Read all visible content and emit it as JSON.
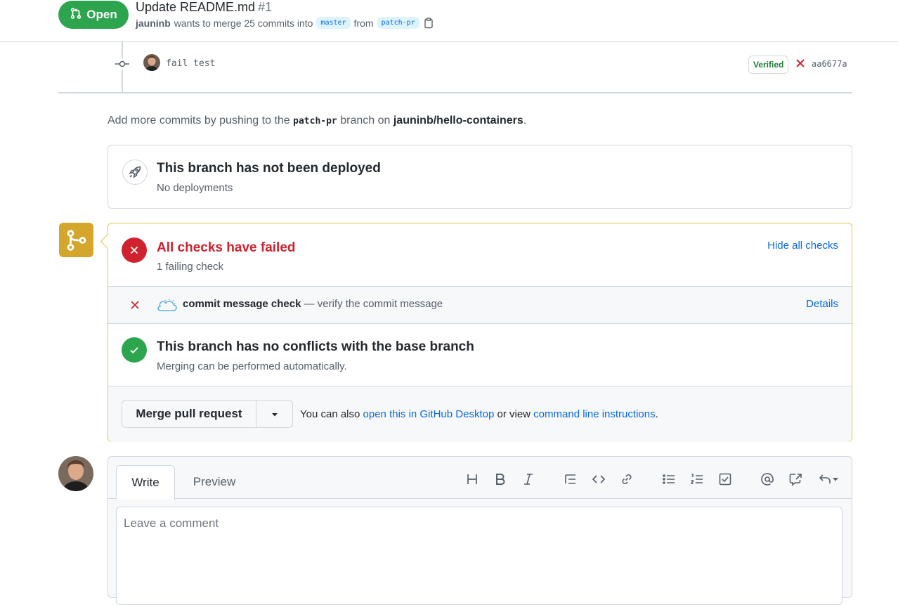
{
  "header": {
    "state": "Open",
    "title": "Update README.md",
    "number": "#1",
    "author": "jauninb",
    "merge_text": "wants to merge 25 commits into",
    "base_branch": "master",
    "from_text": "from",
    "head_branch": "patch-pr"
  },
  "commit": {
    "message": "fail test",
    "verified": "Verified",
    "sha": "aa6677a"
  },
  "push_hint": {
    "prefix": "Add more commits by pushing to the",
    "branch": "patch-pr",
    "middle": "branch on",
    "repo": "jauninb/hello-containers",
    "suffix": "."
  },
  "deployment": {
    "title": "This branch has not been deployed",
    "subtitle": "No deployments"
  },
  "checks": {
    "title": "All checks have failed",
    "subtitle": "1 failing check",
    "toggle_label": "Hide all checks",
    "items": [
      {
        "name": "commit message check",
        "description": "— verify the commit message",
        "link": "Details"
      }
    ]
  },
  "conflicts": {
    "title": "This branch has no conflicts with the base branch",
    "subtitle": "Merging can be performed automatically."
  },
  "merge": {
    "button_label": "Merge pull request",
    "note_prefix": "You can also",
    "desktop_link": "open this in GitHub Desktop",
    "note_middle": "or view",
    "cli_link": "command line instructions",
    "note_suffix": "."
  },
  "comment": {
    "tab_write": "Write",
    "tab_preview": "Preview",
    "placeholder": "Leave a comment",
    "toolbar": [
      "heading-icon",
      "bold-icon",
      "italic-icon",
      "quote-icon",
      "code-icon",
      "link-icon",
      "unordered-list-icon",
      "ordered-list-icon",
      "task-list-icon",
      "mention-icon",
      "cross-reference-icon",
      "saved-replies-icon"
    ]
  },
  "colors": {
    "open_green": "#2da44e",
    "danger_red": "#cf222e",
    "success_green": "#2da44e",
    "merge_yellow": "#d4a72c",
    "link_blue": "#0969da"
  }
}
